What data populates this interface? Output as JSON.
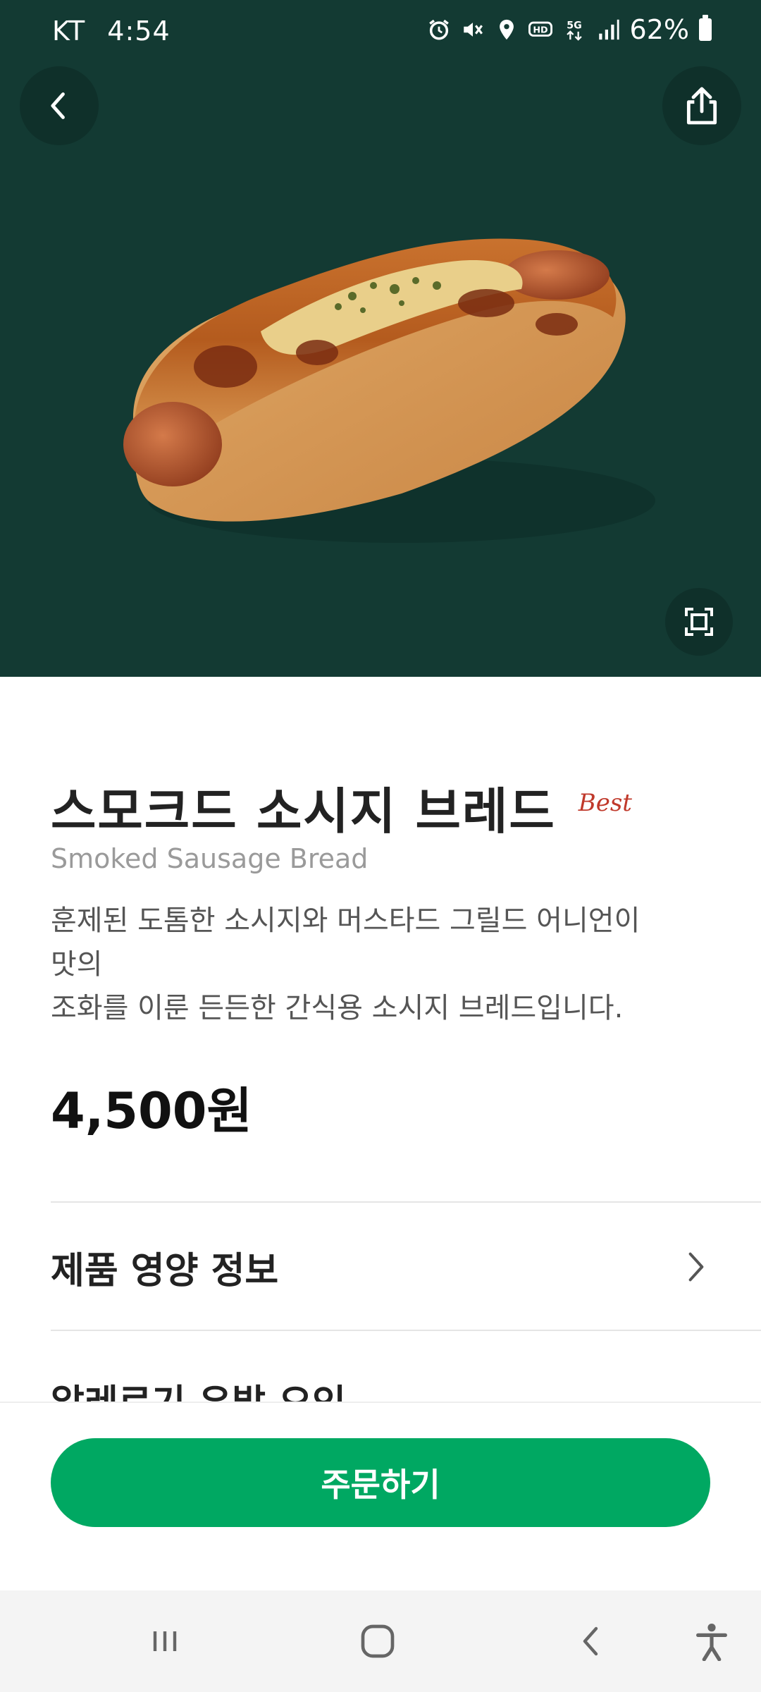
{
  "status": {
    "carrier": "KT",
    "time": "4:54",
    "battery": "62%",
    "icons": [
      "alarm-icon",
      "mute-icon",
      "location-icon",
      "hd-icon",
      "5g-icon",
      "signal-icon",
      "battery-icon"
    ]
  },
  "header": {
    "back_icon": "chevron-left-icon",
    "share_icon": "share-icon",
    "expand_icon": "fullscreen-icon"
  },
  "product": {
    "name": "스모크드 소시지 브레드",
    "badge": "Best",
    "english_name": "Smoked Sausage Bread",
    "description_line1": "훈제된 도톰한 소시지와 머스타드 그릴드 어니언이",
    "description_line2": "맛의",
    "description_line3": "조화를 이룬 든든한 간식용 소시지 브레드입니다.",
    "price": "4,500원"
  },
  "sections": {
    "nutrition_label": "제품 영양 정보",
    "allergy_label": "알레르기 유발 요인"
  },
  "footer": {
    "order_label": "주문하기"
  },
  "colors": {
    "hero_bg": "#133a33",
    "order_button": "#00a862",
    "badge": "#c0392b"
  },
  "navbar": {
    "icons": [
      "recent-apps-icon",
      "home-icon",
      "back-icon",
      "accessibility-icon"
    ]
  }
}
